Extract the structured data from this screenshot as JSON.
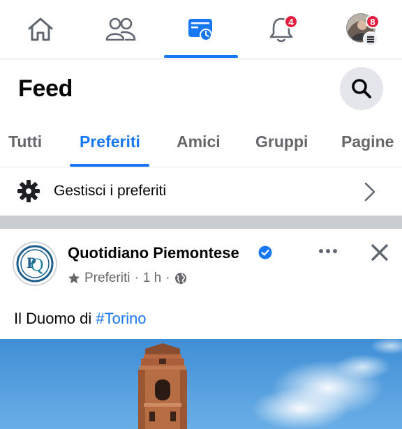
{
  "nav": {
    "items": [
      {
        "name": "home-icon"
      },
      {
        "name": "friends-icon"
      },
      {
        "name": "feeds-icon",
        "active": true
      },
      {
        "name": "notifications-bell-icon",
        "badge": "4"
      },
      {
        "name": "profile-menu-avatar",
        "badge": "8"
      }
    ]
  },
  "header": {
    "title": "Feed",
    "search_icon": "search-icon"
  },
  "tabs": [
    "Tutti",
    "Preferiti",
    "Amici",
    "Gruppi",
    "Pagine"
  ],
  "active_tab": "Preferiti",
  "manage": {
    "label": "Gestisci i preferiti",
    "icon": "gear-icon"
  },
  "post": {
    "author": "Quotidiano Piemontese",
    "avatar_letters": "P Q",
    "meta_label": "Preferiti",
    "meta_time": "1 h",
    "meta_sep": "·",
    "text_prefix": "Il Duomo di ",
    "hashtag": "#Torino"
  },
  "colors": {
    "accent": "#1877f2",
    "badge": "#e41e3f",
    "muted": "#65676b"
  }
}
